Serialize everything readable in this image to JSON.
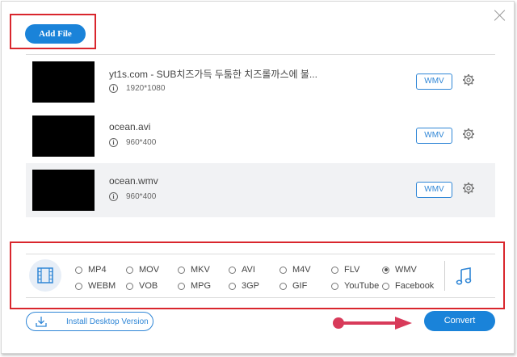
{
  "toolbar": {
    "add_file_label": "Add File"
  },
  "files": [
    {
      "name": "yt1s.com - SUB치즈가득 두툼한 치즈롤까스에 불...",
      "resolution": "1920*1080",
      "format": "WMV"
    },
    {
      "name": "ocean.avi",
      "resolution": "960*400",
      "format": "WMV"
    },
    {
      "name": "ocean.wmv",
      "resolution": "960*400",
      "format": "WMV"
    }
  ],
  "formats": {
    "selected": "WMV",
    "options": [
      "MP4",
      "MOV",
      "MKV",
      "AVI",
      "M4V",
      "FLV",
      "WMV",
      "WEBM",
      "VOB",
      "MPG",
      "3GP",
      "GIF",
      "YouTube",
      "Facebook"
    ]
  },
  "footer": {
    "install_label": "Install Desktop Version",
    "convert_label": "Convert"
  },
  "icons": {
    "close": "close-icon",
    "info": "info-icon",
    "gear": "gear-icon",
    "film": "film-icon",
    "music": "music-note-icon",
    "download": "download-icon",
    "arrow": "arrow-right-icon"
  },
  "colors": {
    "accent": "#1a83d9",
    "highlight": "#d9262d",
    "arrow": "#d83a5a"
  }
}
